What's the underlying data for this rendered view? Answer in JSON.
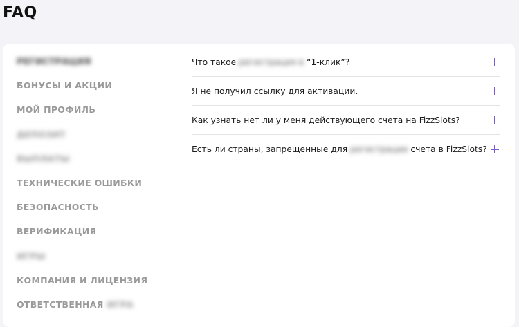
{
  "page": {
    "title": "FAQ"
  },
  "sidebar": {
    "items": [
      {
        "label": "Регистрация",
        "blurred": true,
        "active": true
      },
      {
        "label": "Бонусы и акции",
        "blurred": false
      },
      {
        "label": "Мой профиль",
        "blurred": false
      },
      {
        "label": "Депозит",
        "blurred": true
      },
      {
        "label": "Выплаты",
        "blurred": true
      },
      {
        "label": "Технические ошибки",
        "blurred": false
      },
      {
        "label": "Безопасность",
        "blurred": false
      },
      {
        "label": "Верификация",
        "blurred": false
      },
      {
        "label": "Игры",
        "blurred": true
      },
      {
        "label": "Компания и лицензия",
        "blurred": false
      },
      {
        "label_visible": "Ответственная",
        "label_blurred": "игра"
      }
    ]
  },
  "questions": [
    {
      "pre": "Что такое ",
      "blurred": "регистрация в",
      "post": " “1-клик”?"
    },
    {
      "pre": "Я не получил ссылку для активации.",
      "blurred": "",
      "post": ""
    },
    {
      "pre": "Как узнать нет ли у меня действующего счета на FizzSlots?",
      "blurred": "",
      "post": ""
    },
    {
      "pre": "Есть ли страны, запрещенные для ",
      "blurred": "регистрации",
      "post": " счета в FizzSlots?"
    }
  ],
  "icons": {
    "expand": "plus-icon"
  },
  "colors": {
    "accent": "#7a5bd6",
    "background": "#f4f4f8",
    "card": "#ffffff"
  }
}
